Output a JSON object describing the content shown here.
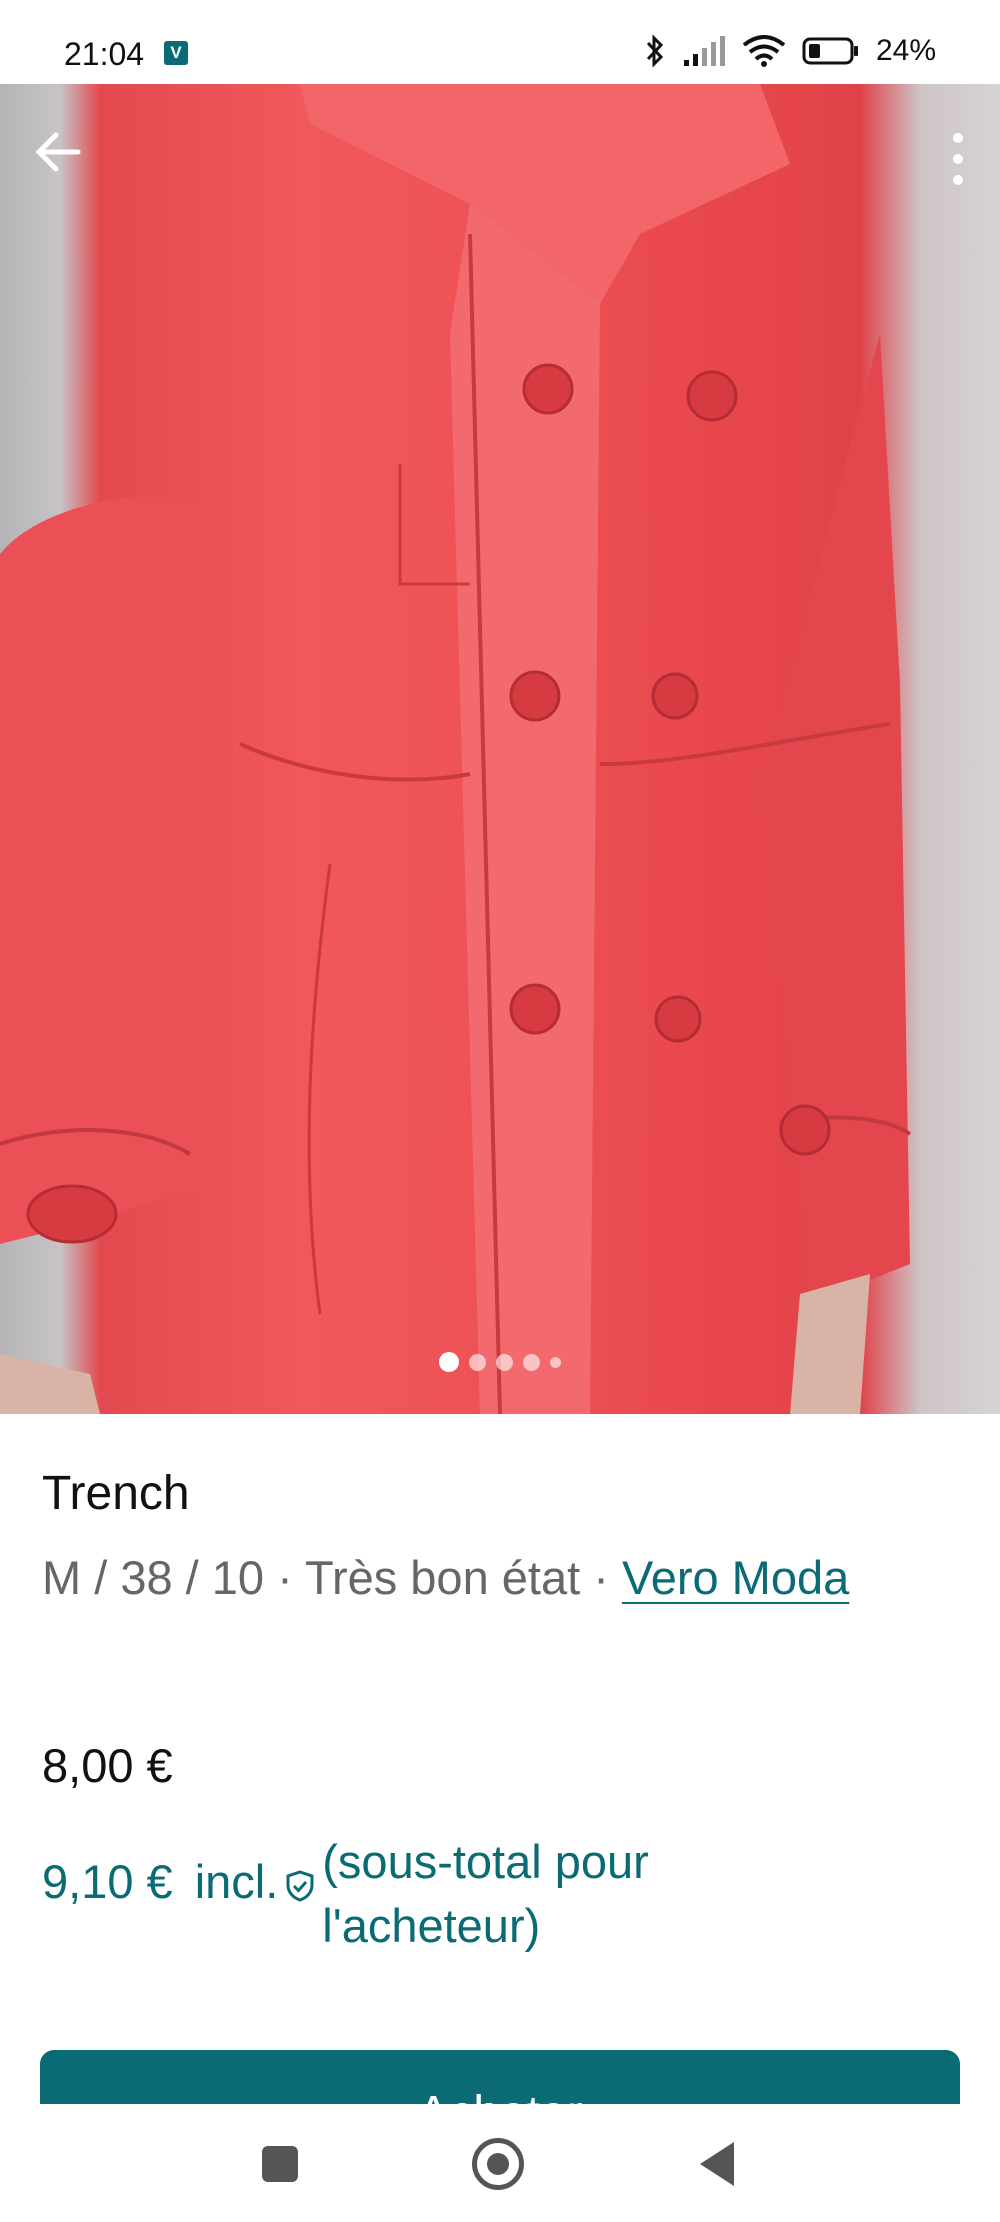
{
  "status_bar": {
    "time": "21:04",
    "app_badge": "V",
    "battery": "24%",
    "icons": [
      "bluetooth-icon",
      "signal-icon",
      "wifi-icon",
      "battery-icon"
    ]
  },
  "photo": {
    "description_icons": [
      "back-arrow-icon",
      "more-vert-icon"
    ],
    "page_count": 5,
    "active_page": 1
  },
  "item": {
    "title": "Trench",
    "meta_prefix": "M / 38 / 10 · Très bon état · ",
    "brand": "Vero Moda",
    "price": "8,00 €",
    "total_price": "9,10 €",
    "total_incl": "incl.",
    "subtotal_note": "(sous-total pour l'acheteur)"
  },
  "actions": {
    "buy_label": "Acheter"
  },
  "colors": {
    "accent": "#0b6b74",
    "garment": "#ee5155"
  }
}
